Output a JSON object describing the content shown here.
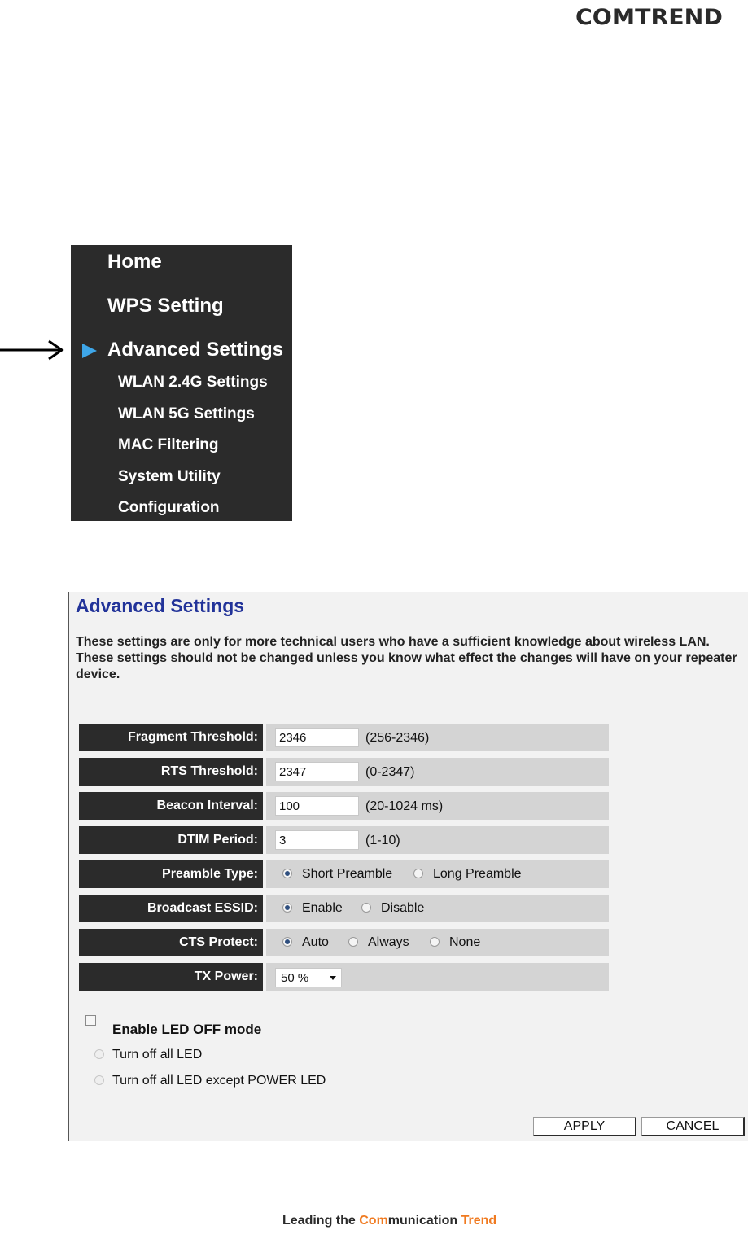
{
  "brand": {
    "logo": "COMTREND"
  },
  "sidebar": {
    "items": [
      {
        "label": "Home"
      },
      {
        "label": "WPS Setting"
      },
      {
        "label": "Advanced Settings"
      },
      {
        "label": "WLAN 2.4G Settings"
      },
      {
        "label": "WLAN 5G Settings"
      },
      {
        "label": "MAC Filtering"
      },
      {
        "label": "System Utility"
      },
      {
        "label": "Configuration"
      }
    ]
  },
  "panel": {
    "title": "Advanced Settings",
    "description": "These settings are only for more technical users who have a sufficient knowledge about wireless LAN. These settings should not be changed unless you know what effect the changes will have on your repeater device.",
    "fields": {
      "fragment": {
        "label": "Fragment Threshold:",
        "value": "2346",
        "range": "(256-2346)"
      },
      "rts": {
        "label": "RTS Threshold:",
        "value": "2347",
        "range": "(0-2347)"
      },
      "beacon": {
        "label": "Beacon Interval:",
        "value": "100",
        "range": "(20-1024 ms)"
      },
      "dtim": {
        "label": "DTIM Period:",
        "value": "3",
        "range": "(1-10)"
      },
      "preamble": {
        "label": "Preamble Type:",
        "options": [
          "Short Preamble",
          "Long Preamble"
        ],
        "selected": "Short Preamble"
      },
      "essid": {
        "label": "Broadcast ESSID:",
        "options": [
          "Enable",
          "Disable"
        ],
        "selected": "Enable"
      },
      "cts": {
        "label": "CTS Protect:",
        "options": [
          "Auto",
          "Always",
          "None"
        ],
        "selected": "Auto"
      },
      "txpower": {
        "label": "TX Power:",
        "value": "50 %"
      }
    },
    "led": {
      "title": "Enable LED OFF mode",
      "checked": false,
      "options": [
        "Turn off all LED",
        "Turn off all LED except POWER LED"
      ]
    },
    "buttons": {
      "apply": "APPLY",
      "cancel": "CANCEL"
    }
  },
  "footer": {
    "tagline_part1": "Leading the ",
    "tagline_part2": "Com",
    "tagline_part3": "munication ",
    "tagline_part4": "Trend"
  },
  "colors": {
    "accent_blue": "#3ea6e8",
    "title_blue": "#223399",
    "dark": "#2b2b2b",
    "tagline_orange": "#f07a20"
  }
}
